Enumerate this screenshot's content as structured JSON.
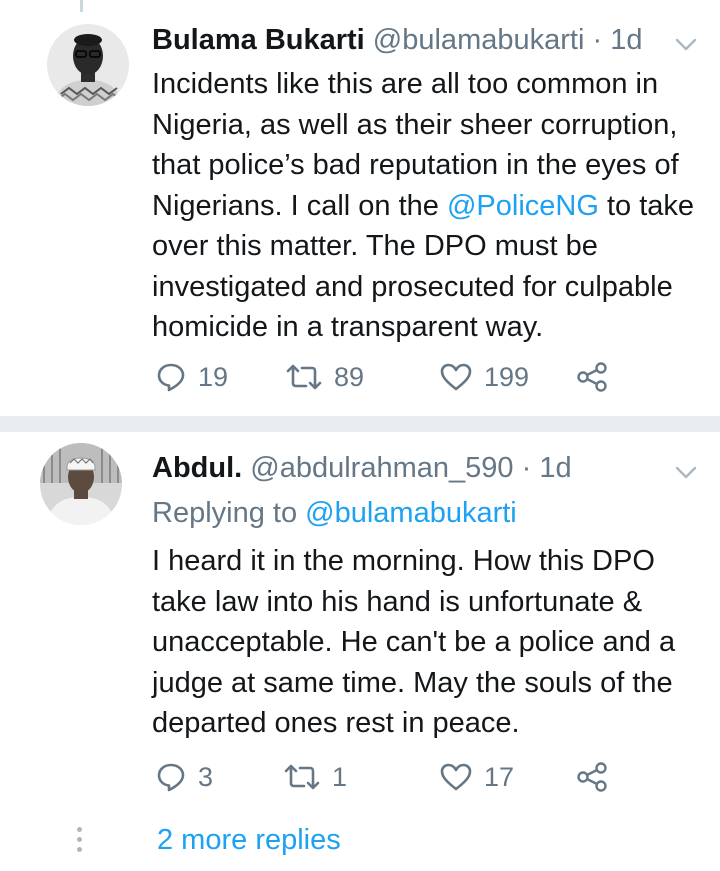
{
  "tweets": [
    {
      "name": "Bulama Bukarti",
      "handle": "@bulamabukarti",
      "separator": "·",
      "time": "1d",
      "text_before": "Incidents like this are all too common in Nigeria, as well as their sheer corruption, that police’s bad reputation in the eyes of Nigerians. I call on the ",
      "mention": "@PoliceNG",
      "text_after": " to take over this matter. The DPO must be investigated and prosecuted for culpable homicide in a transparent way.",
      "replies": "19",
      "retweets": "89",
      "likes": "199"
    },
    {
      "name": "Abdul.",
      "handle": "@abdulrahman_590",
      "separator": "·",
      "time": "1d",
      "replying_prefix": "Replying to ",
      "replying_to": "@bulamabukarti",
      "text": "I heard it in the morning. How this DPO take law into his hand is unfortunate & unacceptable. He can't be a police and a judge at same time. May the souls of the departed ones rest in peace.",
      "replies": "3",
      "retweets": "1",
      "likes": "17"
    }
  ],
  "more_replies": "2 more replies",
  "icons": {
    "reply": "reply-icon",
    "retweet": "retweet-icon",
    "like": "heart-icon",
    "share": "share-icon",
    "menu": "chevron-down-icon"
  },
  "colors": {
    "link": "#1da1f2",
    "secondary": "#657786",
    "divider": "#e6ecf0"
  }
}
